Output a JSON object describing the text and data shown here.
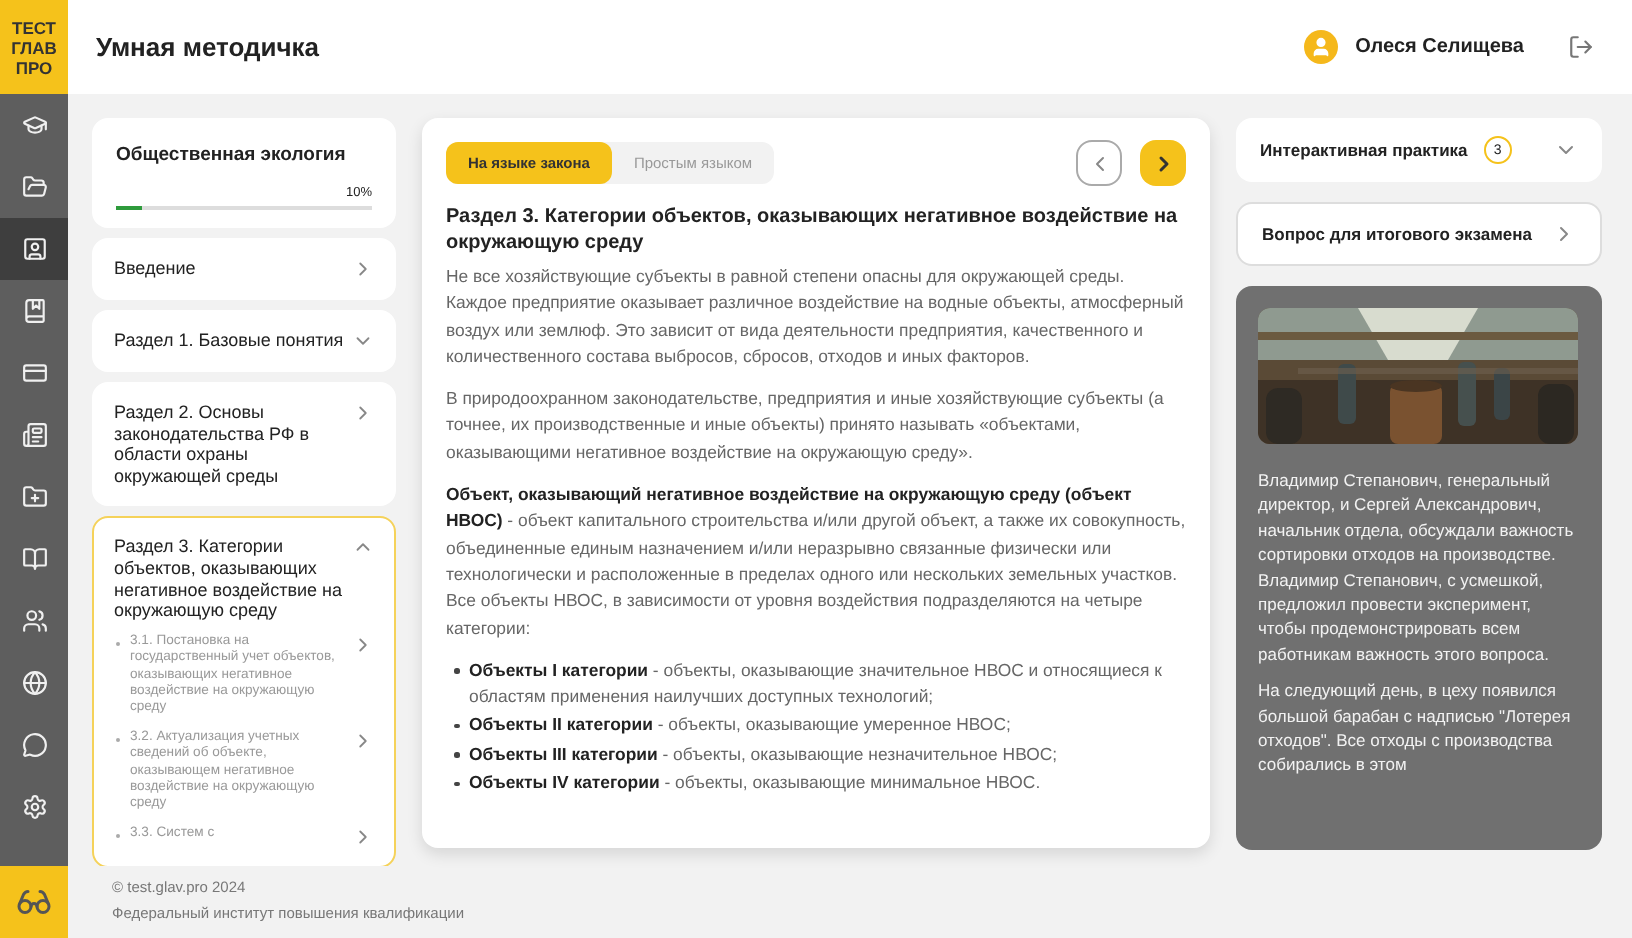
{
  "logo": {
    "lines": [
      "ТЕСТ",
      "ГЛАВ",
      "ПРО"
    ]
  },
  "header": {
    "title": "Умная методичка",
    "user": "Олеся Селищева"
  },
  "rail": [
    {
      "selected": false
    },
    {
      "selected": false
    },
    {
      "selected": true
    },
    {
      "selected": false
    },
    {
      "selected": false
    },
    {
      "selected": false
    },
    {
      "selected": false
    },
    {
      "selected": false
    },
    {
      "selected": false
    },
    {
      "selected": false
    },
    {
      "selected": false
    },
    {
      "selected": false
    }
  ],
  "course": {
    "title": "Общественная экология",
    "progress_label": "10%",
    "level": 0.1
  },
  "sections": [
    {
      "kind": "link",
      "title": "Введение",
      "selected": false
    },
    {
      "kind": "group",
      "title": "Раздел 1. Базовые понятия",
      "expanded": false,
      "selected": false
    },
    {
      "kind": "link",
      "title": "Раздел 2. Основы законодательства РФ в области охраны окружающей среды",
      "selected": false
    },
    {
      "kind": "group",
      "title": "Раздел 3. Категории объектов, оказывающих негативное воздействие на окружающую среду",
      "expanded": true,
      "selected": true,
      "children": [
        {
          "title": "3.1. Постановка на государственный учет объектов, оказывающих негативное воздействие на окружающую среду"
        },
        {
          "title": "3.2. Актуализация учетных сведений об объекте, оказывающем негативное воздействие на окружающую среду"
        },
        {
          "title": "3.3. Систем с"
        }
      ]
    }
  ],
  "tabs": [
    {
      "label": "На языке закона",
      "selected": true
    },
    {
      "label": "Простым языком",
      "selected": false
    }
  ],
  "article": {
    "heading": "Раздел 3. Категории объектов, оказывающих негативное воздействие на окружающую среду",
    "paragraphs": [
      "Не все хозяйствующие субъекты в равной степени опасны для окружающей среды. Каждое предприятие оказывает различное воздействие на водные объекты, атмосферный воздух или землюф. Это зависит от вида деятельности предприятия, качественного и количественного состава выбросов, сбросов, отходов и иных факторов.",
      "В природоохранном законодательстве, предприятия и иные хозяйствующие субъекты (а точнее, их производственные и иные объекты) принято называть «объектами, оказывающими негативное воздействие на окружающую среду».",
      "**Объект, оказывающий негативное воздействие на окружающую среду (объект НВОС)** - объект капитального строительства и/или другой объект, а также их совокупность, объединенные единым назначением и/или неразрывно связанные физически или технологически и расположенные в пределах одного или нескольких земельных участков. Все объекты НВОС, в зависимости от уровня воздействия подразделяются на четыре категории:"
    ],
    "bullets": [
      "**Объекты I категории** - объекты, оказывающие значительное НВОС и относящиеся к областям применения наилучших доступных технологий;",
      "**Объекты II категории** - объекты, оказывающие умеренное НВОС;",
      "**Объекты III категории** - объекты, оказывающие незначительное НВОС;",
      "**Объекты IV категории** - объекты, оказывающие минимальное НВОС."
    ]
  },
  "practice": {
    "title": "Интерактивная практика",
    "count": "3"
  },
  "exam": {
    "title": "Вопрос для итогового экзамена"
  },
  "story": {
    "paragraphs": [
      "Владимир Степанович, генеральный директор, и Сергей Александрович, начальник отдела, обсуждали важность сортировки отходов на производстве. Владимир Степанович, с усмешкой, предложил провести эксперимент, чтобы продемонстрировать всем работникам важность этого вопроса.",
      "На следующий день, в цеху появился большой барабан с надписью \"Лотерея отходов\". Все отходы с производства собирались в этом"
    ]
  },
  "footer": [
    "© test.glav.pro 2024",
    "Федеральный институт повышения квалификации"
  ]
}
